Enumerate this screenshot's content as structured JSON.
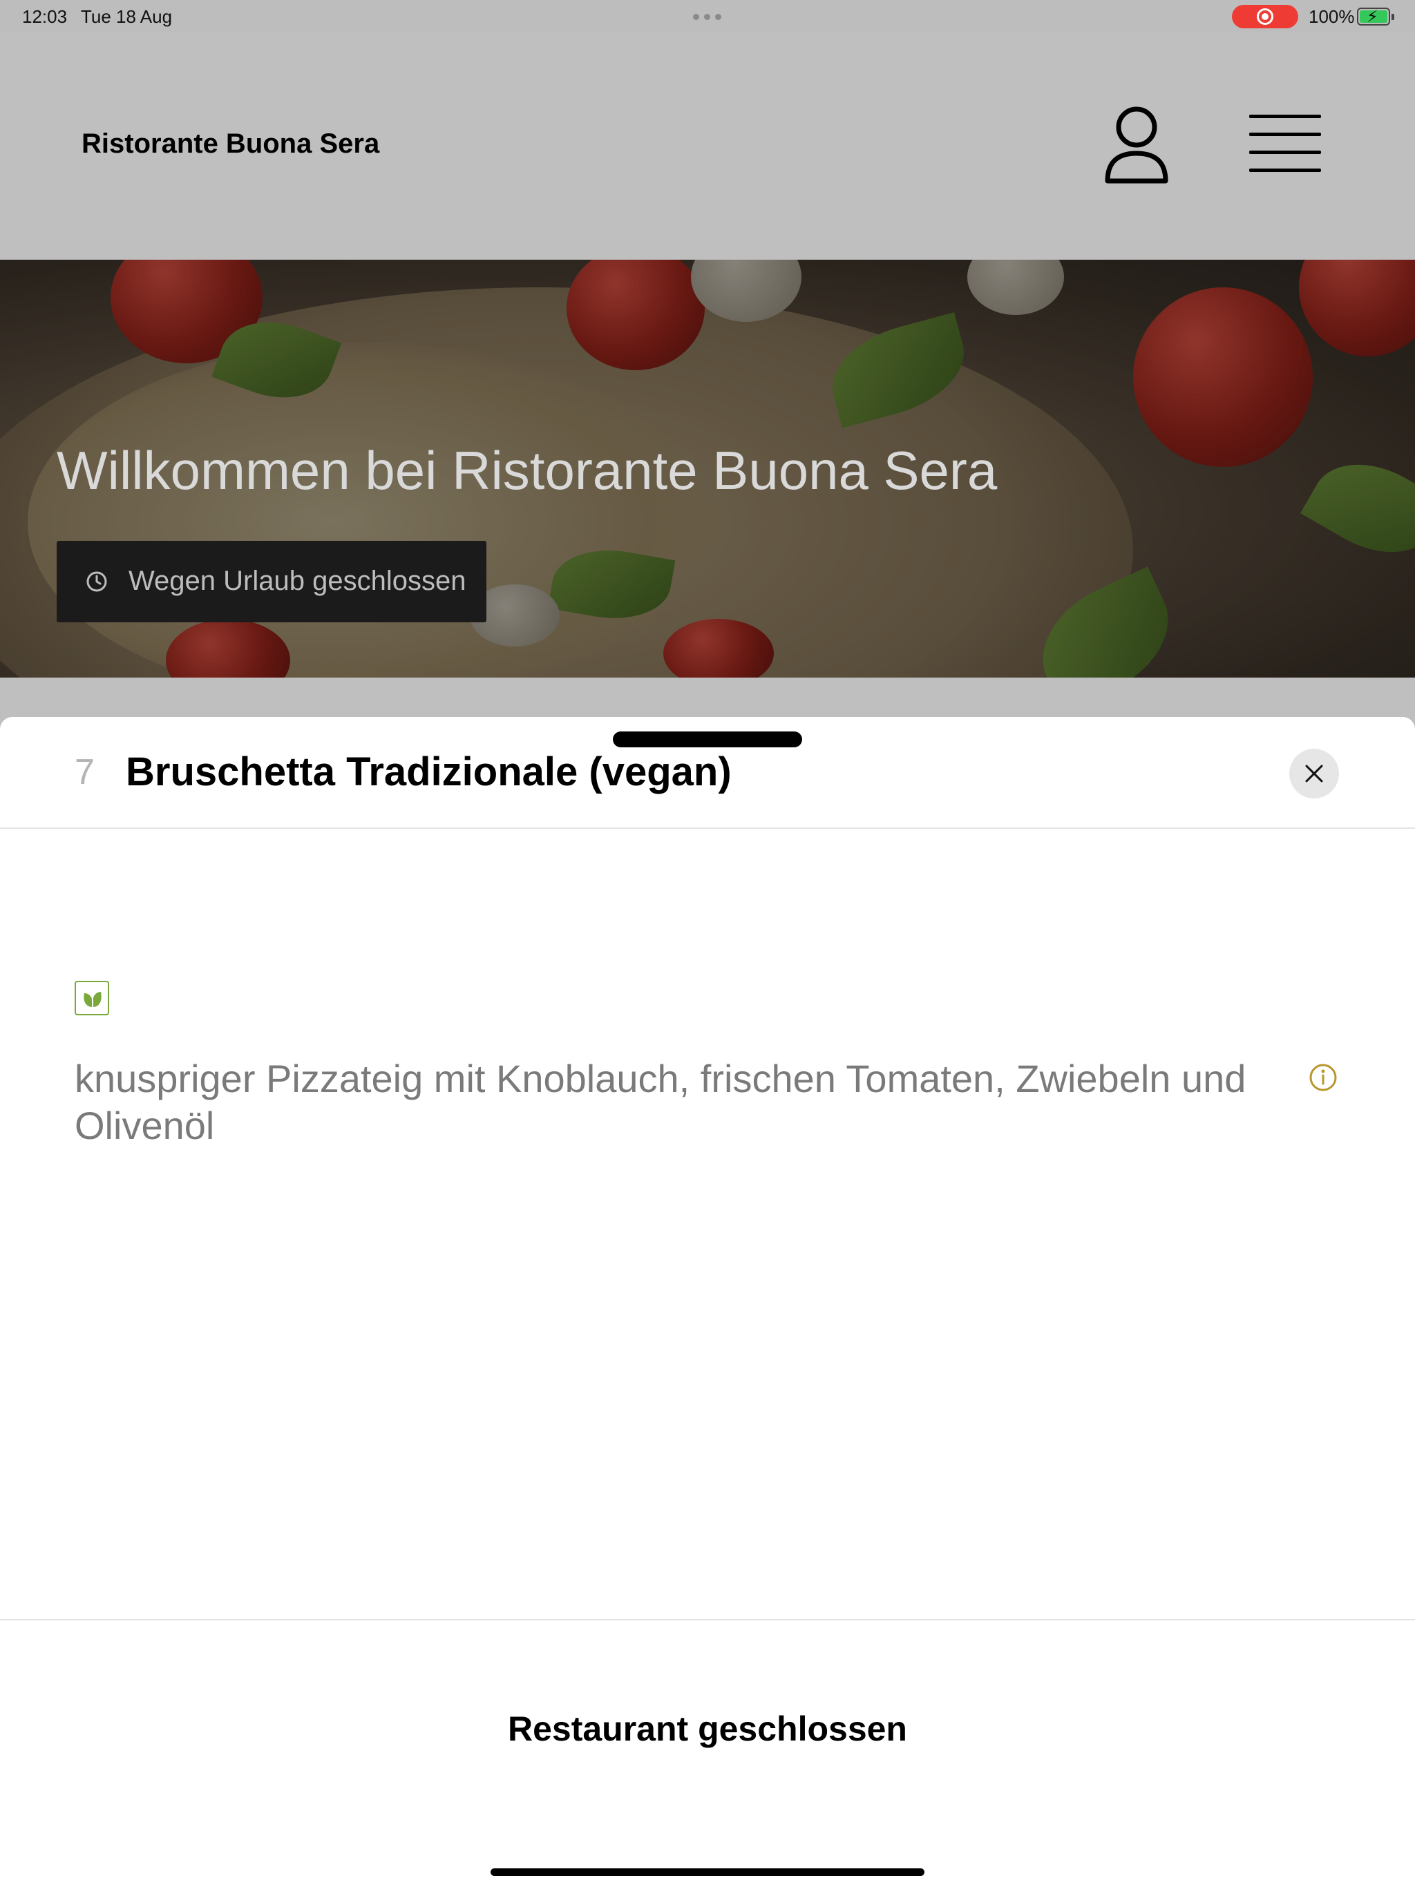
{
  "status_bar": {
    "time": "12:03",
    "date": "Tue 18 Aug",
    "battery": "100%",
    "battery_level_percent": 100,
    "recording_color": "#ee3b34"
  },
  "header": {
    "brand": "Ristorante Buona Sera",
    "icons": [
      "user-icon",
      "menu-icon"
    ]
  },
  "hero": {
    "title": "Willkommen bei Ristorante Buona Sera",
    "status_badge": "Wegen Urlaub geschlossen",
    "status_icon": "clock-icon"
  },
  "sheet": {
    "item_number": "7",
    "item_title": "Bruschetta Tradizionale (vegan)",
    "close_icon": "close-icon",
    "diet_icon": "vegan-leaf-icon",
    "description": "knuspriger Pizzateig mit Knoblauch, frischen Tomaten, Zwiebeln und Olivenöl",
    "info_icon": "info-icon",
    "footer_status": "Restaurant geschlossen"
  },
  "colors": {
    "accent_info": "#b8962e",
    "vegan_green": "#7ba83a",
    "badge_bg": "#1b1b1b"
  }
}
